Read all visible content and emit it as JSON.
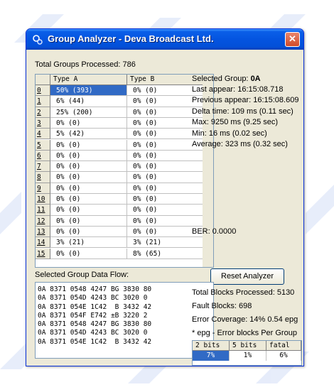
{
  "window": {
    "title": "Group Analyzer - Deva Broadcast Ltd.",
    "close_glyph": "✕"
  },
  "summary": {
    "label": "Total Groups Processed:",
    "value": "786"
  },
  "table": {
    "headers": [
      "Type A",
      "Type B"
    ],
    "rows": [
      {
        "id": "0",
        "a": "50% (393)",
        "b": "0% (0)"
      },
      {
        "id": "1",
        "a": "6% (44)",
        "b": "0% (0)"
      },
      {
        "id": "2",
        "a": "25% (200)",
        "b": "0% (0)"
      },
      {
        "id": "3",
        "a": "0% (0)",
        "b": "0% (0)"
      },
      {
        "id": "4",
        "a": "5% (42)",
        "b": "0% (0)"
      },
      {
        "id": "5",
        "a": "0% (0)",
        "b": "0% (0)"
      },
      {
        "id": "6",
        "a": "0% (0)",
        "b": "0% (0)"
      },
      {
        "id": "7",
        "a": "0% (0)",
        "b": "0% (0)"
      },
      {
        "id": "8",
        "a": "0% (0)",
        "b": "0% (0)"
      },
      {
        "id": "9",
        "a": "0% (0)",
        "b": "0% (0)"
      },
      {
        "id": "10",
        "a": "0% (0)",
        "b": "0% (0)"
      },
      {
        "id": "11",
        "a": "0% (0)",
        "b": "0% (0)"
      },
      {
        "id": "12",
        "a": "0% (0)",
        "b": "0% (0)"
      },
      {
        "id": "13",
        "a": "0% (0)",
        "b": "0% (0)"
      },
      {
        "id": "14",
        "a": "3% (21)",
        "b": "3% (21)"
      },
      {
        "id": "15",
        "a": "0% (0)",
        "b": "8% (65)"
      }
    ]
  },
  "selected": {
    "group_label": "Selected Group:",
    "group_value": "0A",
    "last_appear": "Last appear: 16:15:08.718",
    "prev_appear": "Previous appear: 16:15:08.609",
    "delta": "Delta time: 109 ms (0.11 sec)",
    "max": "Max: 9250 ms (9.25 sec)",
    "min": "Min: 16 ms (0.02 sec)",
    "average": "Average: 323 ms (0.32 sec)"
  },
  "ber": "BER: 0.0000",
  "reset_label": "Reset Analyzer",
  "flow": {
    "label": "Selected Group Data Flow:",
    "lines": [
      "0A 8371 0548 4247 BG 3830 80",
      "0A 8371 054D 4243 BC 3020 0",
      "0A 8371 054E 1C42  B 3432 42",
      "0A 8371 054F E742 ±B 3220 2",
      "0A 8371 0548 4247 BG 3830 80",
      "0A 8371 054D 4243 BC 3020 0",
      "0A 8371 054E 1C42  B 3432 42"
    ]
  },
  "blocks": {
    "total": "Total Blocks Processed: 5130",
    "fault": "Fault Blocks: 698",
    "coverage": "Error Coverage:  14%  0.54 epg",
    "note": "* epg - Error blocks Per Group"
  },
  "bits": {
    "headers": [
      "2 bits",
      "5 bits",
      "fatal"
    ],
    "values": [
      "7%",
      "1%",
      "6%"
    ]
  }
}
